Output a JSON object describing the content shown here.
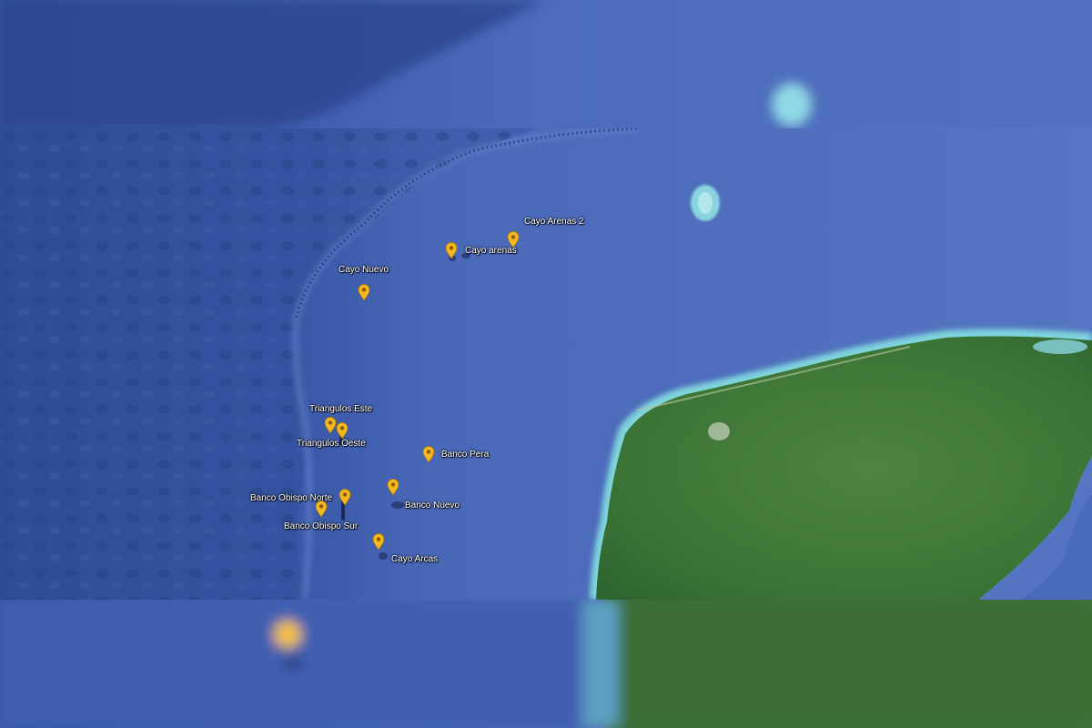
{
  "map": {
    "type": "satellite",
    "colors": {
      "ocean": "#4a67b8",
      "deep_ocean": "#2f4c98",
      "land": "#3f7a3a",
      "reef": "#7fd6e0",
      "pin": "#f5b820"
    },
    "markers": [
      {
        "id": "cayo-arenas-2",
        "label": "Cayo Arenas 2"
      },
      {
        "id": "cayo-arenas",
        "label": "Cayo arenas"
      },
      {
        "id": "cayo-nuevo",
        "label": "Cayo Nuevo"
      },
      {
        "id": "triangulos-este",
        "label": "Triangulos Este"
      },
      {
        "id": "triangulos-oeste",
        "label": "Triangulos Oeste"
      },
      {
        "id": "banco-pera",
        "label": "Banco Pera"
      },
      {
        "id": "banco-nuevo",
        "label": "Banco Nuevo"
      },
      {
        "id": "banco-obispo-norte",
        "label": "Banco Obispo Norte"
      },
      {
        "id": "banco-obispo-sur",
        "label": "Banco Obispo Sur"
      },
      {
        "id": "cayo-arcas",
        "label": "Cayo Arcas"
      }
    ]
  }
}
